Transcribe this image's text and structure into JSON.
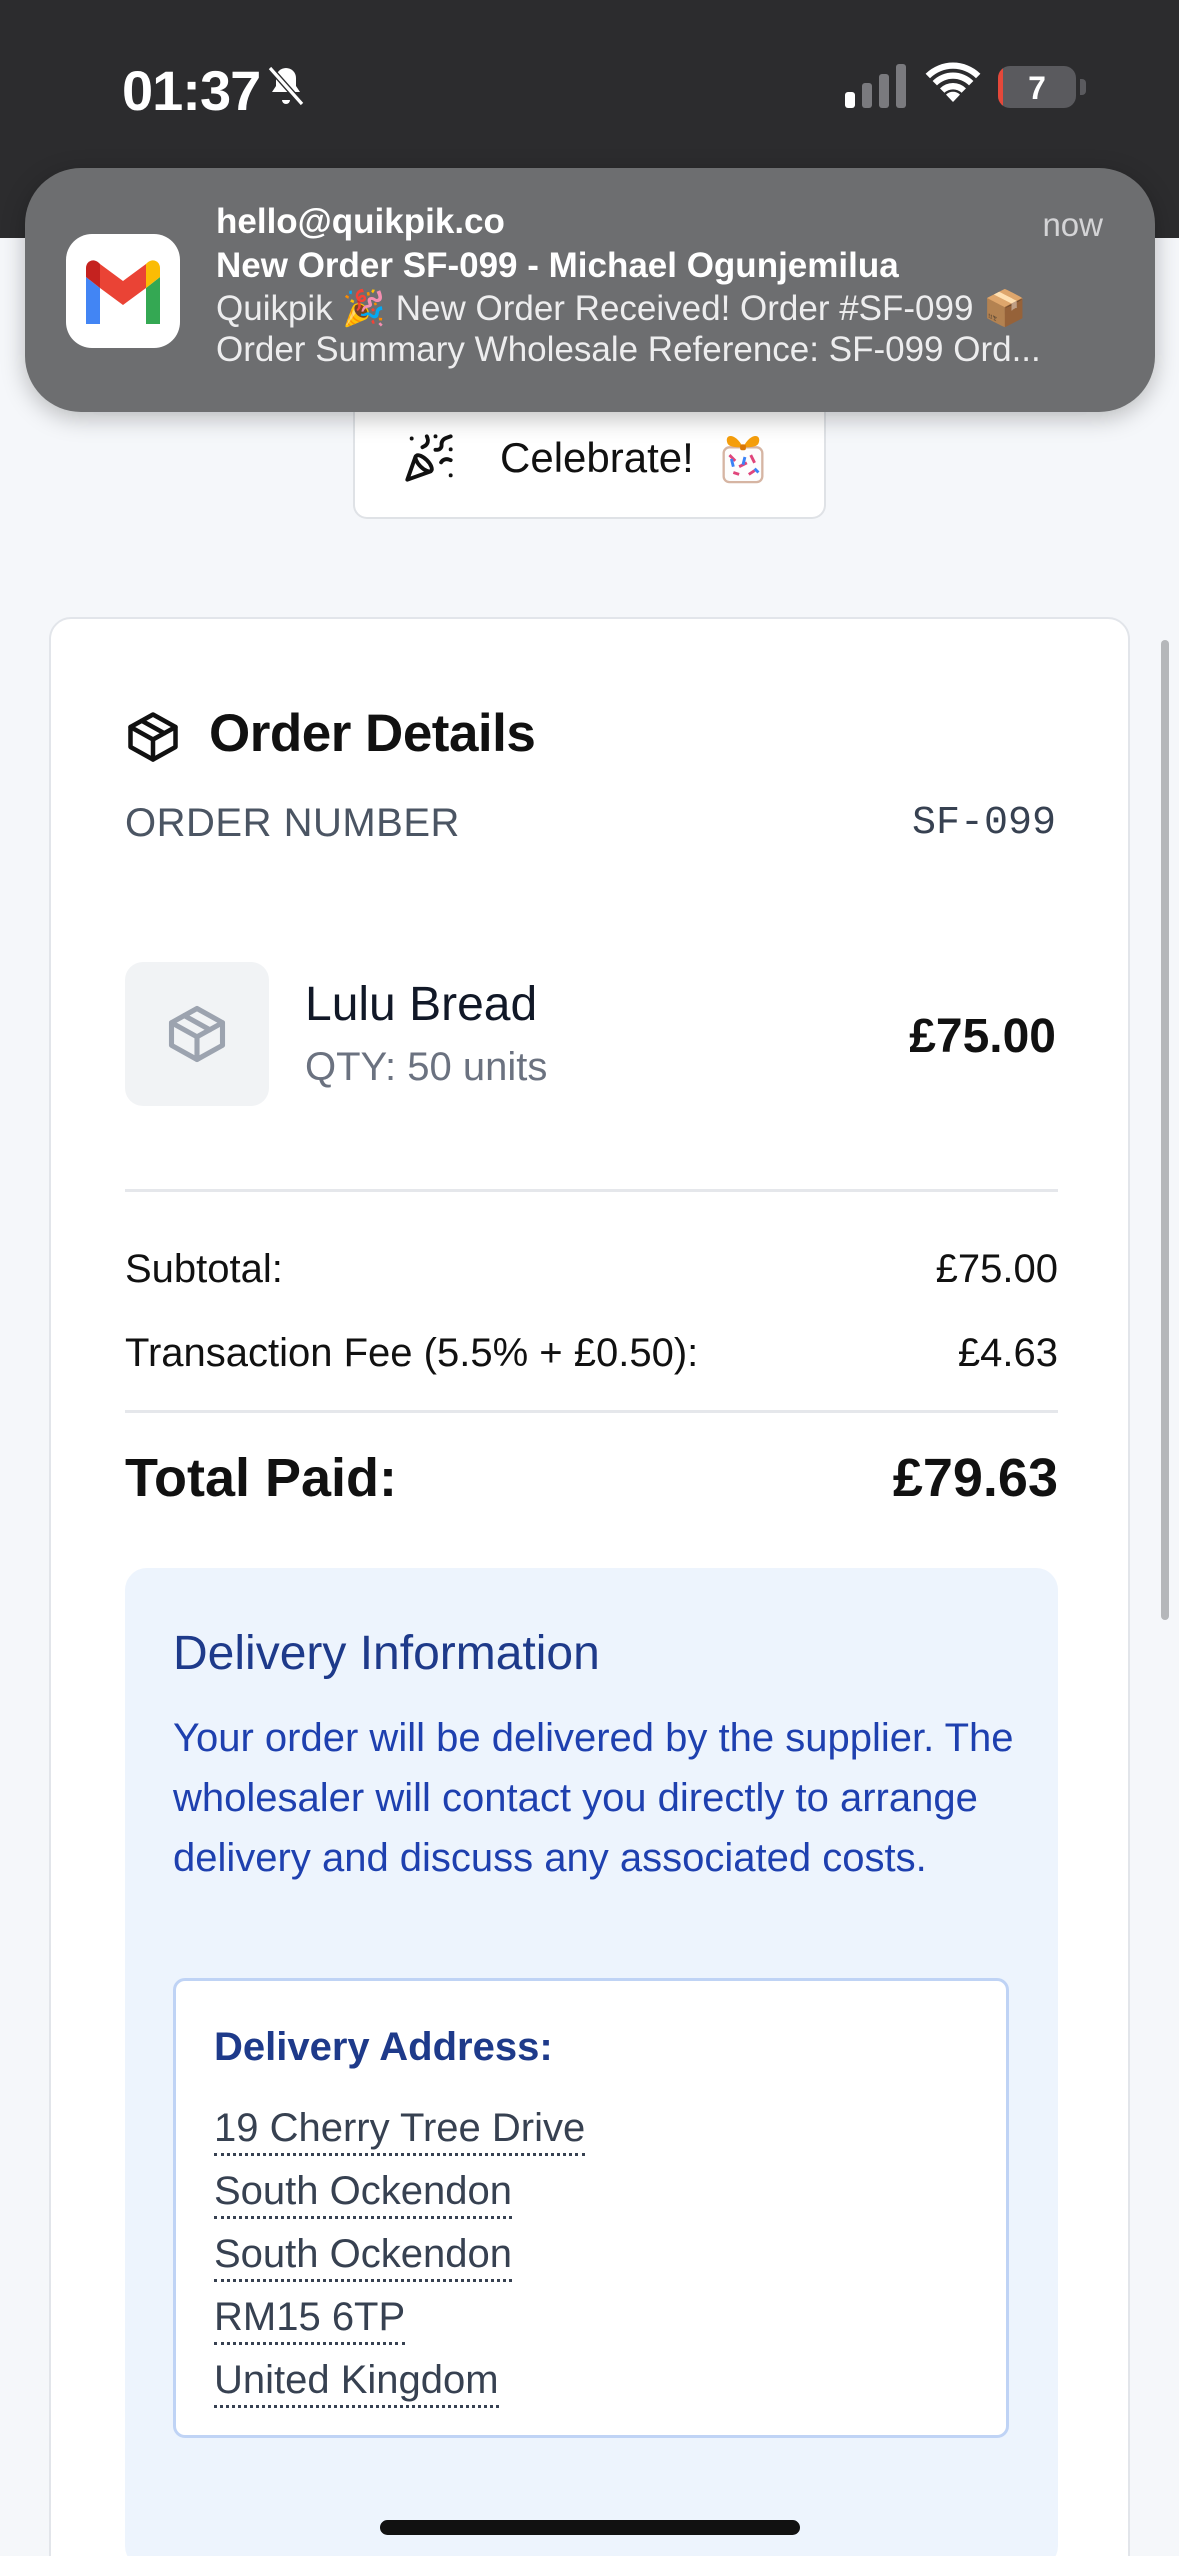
{
  "status_bar": {
    "time": "01:37",
    "battery_level": "7",
    "battery_fraction": 0.07,
    "icons": [
      "bell-slash-icon",
      "cellular-signal-icon",
      "wifi-icon",
      "battery-icon"
    ]
  },
  "notification": {
    "app_icon": "gmail-icon",
    "from": "hello@quikpik.co",
    "time": "now",
    "subject": "New Order SF-099 - Michael Ogunjemilua",
    "line1": "Quikpik 🎉 New Order Received! Order #SF-099 📦",
    "line2": "Order Summary Wholesale Reference: SF-099 Ord..."
  },
  "celebrate": {
    "label": "Celebrate!",
    "icons": [
      "party-popper-icon",
      "gift-icon"
    ]
  },
  "order_details": {
    "title": "Order Details",
    "icon": "package-icon",
    "order_number_label": "ORDER NUMBER",
    "order_number": "SF-099",
    "item": {
      "name": "Lulu Bread",
      "qty": "QTY: 50 units",
      "price": "£75.00"
    },
    "subtotal_label": "Subtotal:",
    "subtotal": "£75.00",
    "fee_label": "Transaction Fee (5.5% + £0.50):",
    "fee": "£4.63",
    "total_label": "Total Paid:",
    "total": "£79.63"
  },
  "delivery": {
    "title": "Delivery Information",
    "text": "Your order will be delivered by the supplier. The wholesaler will contact you directly to arrange delivery and discuss any associated costs.",
    "address_title": "Delivery Address:",
    "address_lines": [
      "19 Cherry Tree Drive",
      "South Ockendon",
      "South Ockendon",
      "RM15 6TP",
      "United Kingdom"
    ]
  },
  "colors": {
    "accent_blue": "#1e40af",
    "delivery_bg": "#edf4fd",
    "battery_low": "#e5483a"
  }
}
